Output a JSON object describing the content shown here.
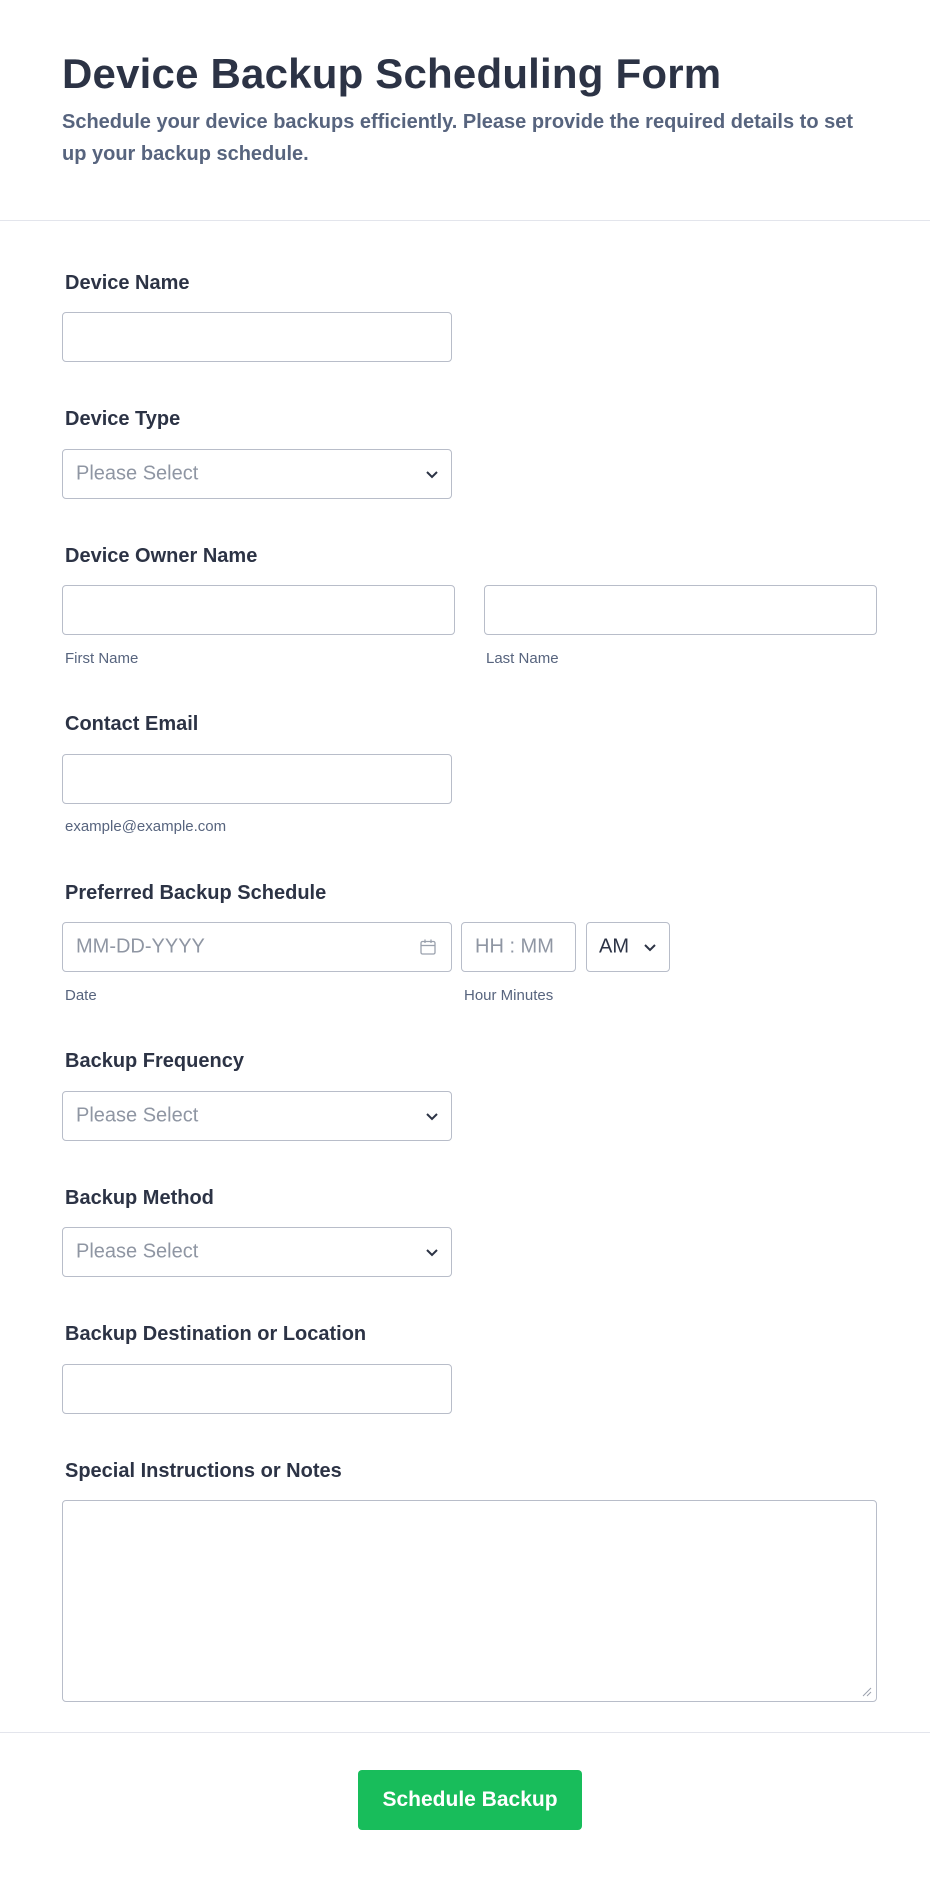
{
  "form": {
    "title": "Device Backup Scheduling Form",
    "description": "Schedule your device backups efficiently. Please provide the required details to set up your backup schedule."
  },
  "fields": {
    "device_name": {
      "label": "Device Name",
      "value": ""
    },
    "device_type": {
      "label": "Device Type",
      "placeholder": "Please Select"
    },
    "owner_name": {
      "label": "Device Owner Name",
      "first_sublabel": "First Name",
      "last_sublabel": "Last Name"
    },
    "contact_email": {
      "label": "Contact Email",
      "sublabel": "example@example.com"
    },
    "schedule": {
      "label": "Preferred Backup Schedule",
      "date_placeholder": "MM-DD-YYYY",
      "date_sublabel": "Date",
      "time_placeholder": "HH : MM",
      "time_sublabel": "Hour Minutes",
      "ampm_value": "AM"
    },
    "frequency": {
      "label": "Backup Frequency",
      "placeholder": "Please Select"
    },
    "method": {
      "label": "Backup Method",
      "placeholder": "Please Select"
    },
    "destination": {
      "label": "Backup Destination or Location",
      "value": ""
    },
    "notes": {
      "label": "Special Instructions or Notes",
      "value": ""
    }
  },
  "submit": {
    "label": "Schedule Backup",
    "color": "#18bd5b"
  },
  "icons": {
    "dropdown": "chevron-down-icon",
    "date": "calendar-icon",
    "resize": "resize-handle-icon"
  }
}
